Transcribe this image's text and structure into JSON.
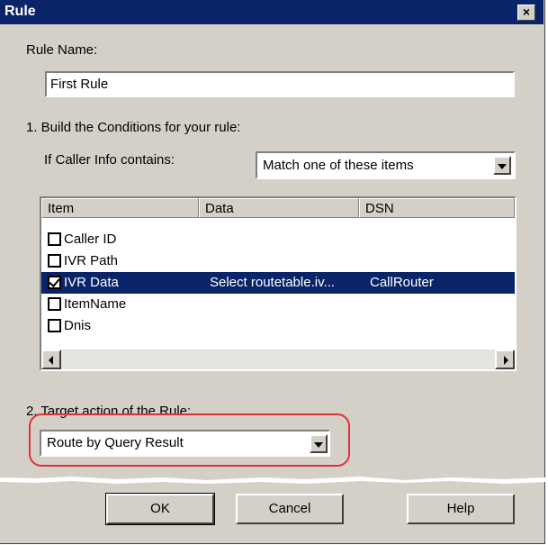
{
  "window": {
    "title": "Rule",
    "close_label": "×"
  },
  "rule_name": {
    "label": "Rule Name:",
    "value": "First Rule"
  },
  "conditions": {
    "section_label": "1. Build the Conditions for your rule:",
    "caller_info_label": "If Caller Info contains:",
    "match_select": {
      "value": "Match one of these items"
    },
    "list": {
      "columns": [
        "Item",
        "Data",
        "DSN"
      ],
      "rows": [
        {
          "checked": false,
          "item": "Caller ID",
          "data": "",
          "dsn": ""
        },
        {
          "checked": false,
          "item": "IVR Path",
          "data": "",
          "dsn": ""
        },
        {
          "checked": true,
          "item": "IVR Data",
          "data": "Select routetable.iv...",
          "dsn": "CallRouter",
          "selected": true
        },
        {
          "checked": false,
          "item": "ItemName",
          "data": "",
          "dsn": ""
        },
        {
          "checked": false,
          "item": "Dnis",
          "data": "",
          "dsn": ""
        }
      ]
    }
  },
  "target": {
    "section_label": "2. Target action of the Rule:",
    "action_select": {
      "value": "Route by Query Result"
    },
    "highlight_color": "#e0303a"
  },
  "buttons": {
    "ok": "OK",
    "cancel": "Cancel",
    "help": "Help"
  },
  "colors": {
    "title_bar": "#0a246a",
    "selection": "#0a246a",
    "dialog_face": "#d4d0c8"
  }
}
